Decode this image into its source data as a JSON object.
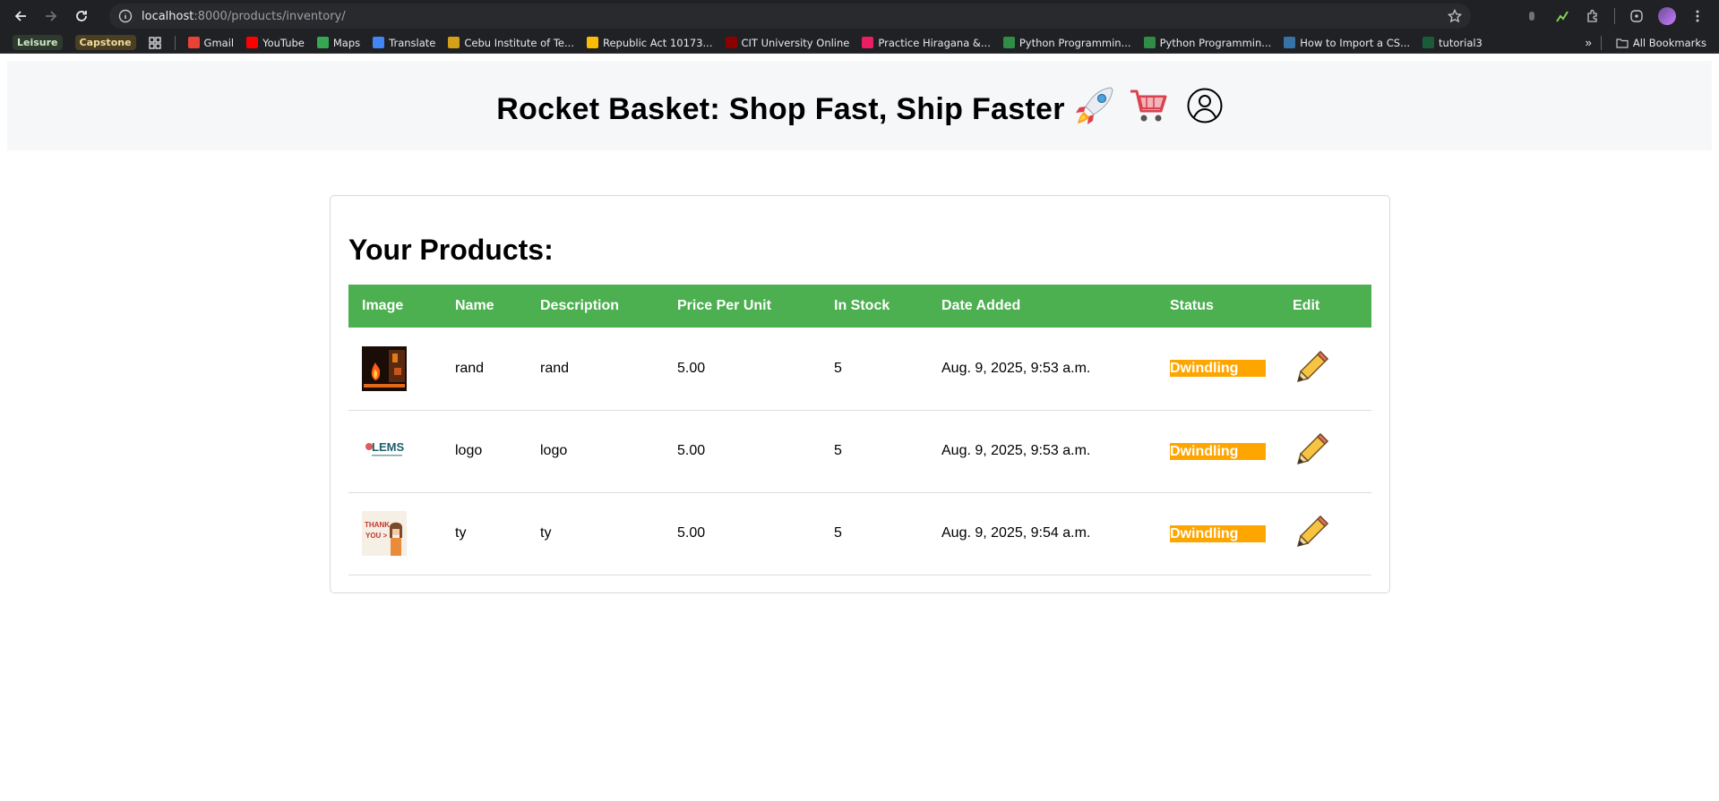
{
  "browser": {
    "url_host": "localhost",
    "url_rest": ":8000/products/inventory/",
    "bookmarks": [
      {
        "label": "Leisure",
        "type": "chip",
        "bg": "#2f3a2e",
        "fg": "#cde8c4"
      },
      {
        "label": "Capstone",
        "type": "chip",
        "bg": "#4a3f22",
        "fg": "#f1dc9a"
      },
      {
        "label": "",
        "type": "apps"
      },
      {
        "label": "Gmail",
        "type": "fav",
        "color": "#ea4335"
      },
      {
        "label": "YouTube",
        "type": "fav",
        "color": "#ff0000"
      },
      {
        "label": "Maps",
        "type": "fav",
        "color": "#34a853"
      },
      {
        "label": "Translate",
        "type": "fav",
        "color": "#4285f4"
      },
      {
        "label": "Cebu Institute of Te...",
        "type": "fav",
        "color": "#d4a017"
      },
      {
        "label": "Republic Act 10173...",
        "type": "fav",
        "color": "#fbbc04"
      },
      {
        "label": "CIT University Online",
        "type": "fav",
        "color": "#8b0000"
      },
      {
        "label": "Practice Hiragana &...",
        "type": "fav",
        "color": "#e91e63"
      },
      {
        "label": "Python Programmin...",
        "type": "fav",
        "color": "#2f8d46"
      },
      {
        "label": "Python Programmin...",
        "type": "fav",
        "color": "#2f8d46"
      },
      {
        "label": "How to Import a CS...",
        "type": "fav",
        "color": "#3572a5"
      },
      {
        "label": "tutorial3",
        "type": "fav",
        "color": "#1a5c3a"
      }
    ],
    "all_bookmarks": "All Bookmarks"
  },
  "header": {
    "title": "Rocket Basket: Shop Fast, Ship Faster"
  },
  "inventory": {
    "heading": "Your Products:",
    "columns": [
      "Image",
      "Name",
      "Description",
      "Price Per Unit",
      "In Stock",
      "Date Added",
      "Status",
      "Edit"
    ],
    "rows": [
      {
        "name": "rand",
        "description": "rand",
        "price": "5.00",
        "stock": "5",
        "date": "Aug. 9, 2025, 9:53 a.m.",
        "status": "Dwindling",
        "thumb": "fire"
      },
      {
        "name": "logo",
        "description": "logo",
        "price": "5.00",
        "stock": "5",
        "date": "Aug. 9, 2025, 9:53 a.m.",
        "status": "Dwindling",
        "thumb": "lems"
      },
      {
        "name": "ty",
        "description": "ty",
        "price": "5.00",
        "stock": "5",
        "date": "Aug. 9, 2025, 9:54 a.m.",
        "status": "Dwindling",
        "thumb": "thankyou"
      }
    ],
    "thumb_logo_text": "LEMS",
    "thumb_ty_text": [
      "THANK",
      "YOU >"
    ]
  },
  "colors": {
    "table_header": "#4caf50",
    "status_dwindling": "#ffa500"
  }
}
